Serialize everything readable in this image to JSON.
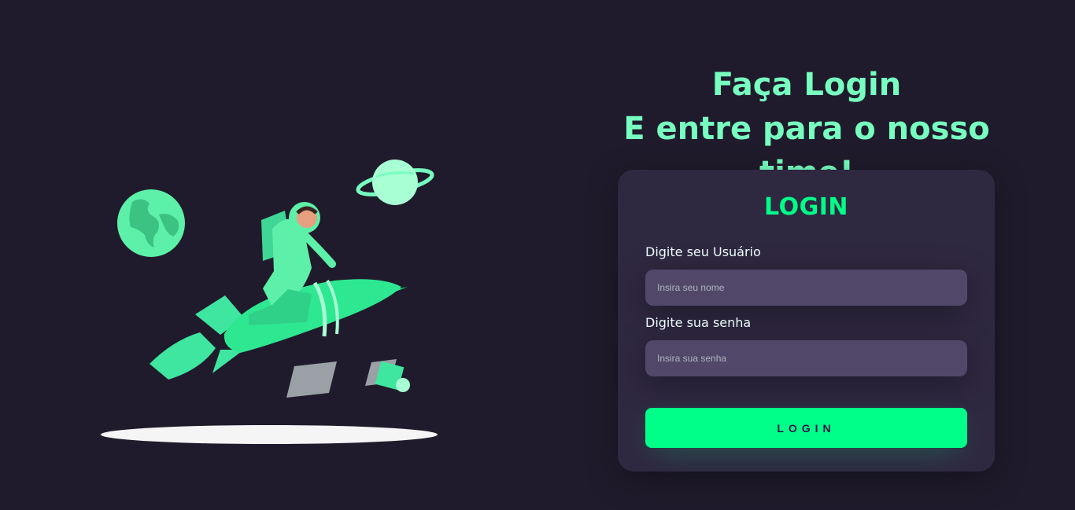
{
  "headline": {
    "line1": "Faça Login",
    "line2": "E entre para o nosso time!"
  },
  "login_card": {
    "title": "LOGIN",
    "username": {
      "label": "Digite seu Usuário",
      "placeholder": "Insira seu nome",
      "value": ""
    },
    "password": {
      "label": "Digite sua senha",
      "placeholder": "Insira sua senha",
      "value": ""
    },
    "submit_label": "LOGIN"
  },
  "illustration": {
    "icon": "astronaut-rocket-illustration"
  },
  "colors": {
    "background": "#201b2c",
    "card": "#2f2841",
    "input": "#514869",
    "accent": "#00ff88",
    "headline": "#77ffc0"
  }
}
